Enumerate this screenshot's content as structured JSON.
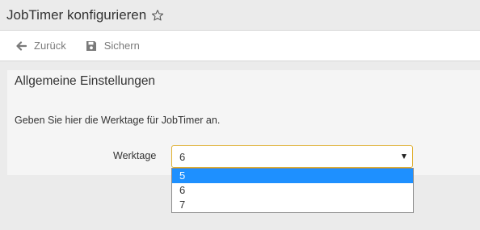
{
  "header": {
    "title": "JobTimer konfigurieren",
    "favorite_icon": "star-outline-icon"
  },
  "toolbar": {
    "back_label": "Zurück",
    "back_icon": "arrow-left-icon",
    "save_label": "Sichern",
    "save_icon": "floppy-disk-icon"
  },
  "section": {
    "title": "Allgemeine Einstellungen",
    "description": "Geben Sie hier die Werktage für JobTimer an."
  },
  "form": {
    "workdays_label": "Werktage",
    "workdays_value": "6",
    "workdays_options": [
      "5",
      "6",
      "7"
    ],
    "highlighted_option": "5"
  },
  "colors": {
    "focus_border": "#e0b030",
    "highlight": "#1e90ff"
  }
}
